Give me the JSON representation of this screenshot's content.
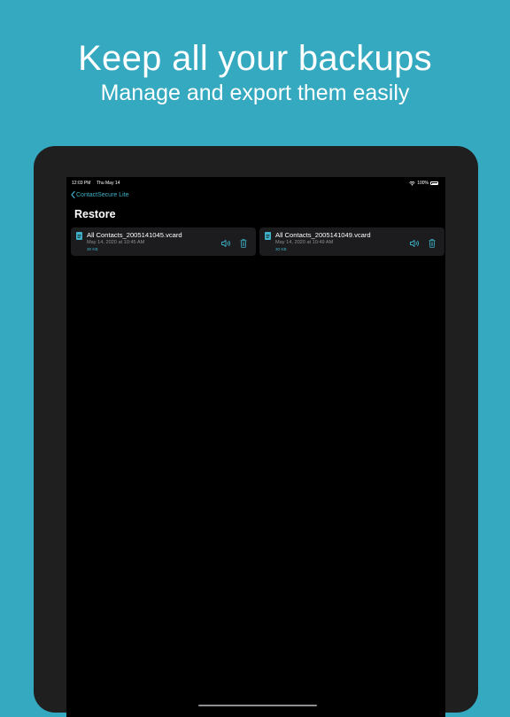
{
  "promo": {
    "headline": "Keep all your backups",
    "subheadline": "Manage and export them easily"
  },
  "status_bar": {
    "time": "12:03 PM",
    "date": "Thu May 14",
    "battery": "100%"
  },
  "nav": {
    "back_label": "ContactSecure Lite",
    "title": "Restore"
  },
  "backups": [
    {
      "name": "All Contacts_2005141045.vcard",
      "date": "May 14, 2020 at 10:45 AM",
      "size": "30 KB"
    },
    {
      "name": "All Contacts_2005141049.vcard",
      "date": "May 14, 2020 at 10:49 AM",
      "size": "30 KB"
    }
  ],
  "colors": {
    "background": "#35a9bf",
    "accent": "#3db2c9",
    "device_frame": "#1f1f1f",
    "screen": "#000000",
    "card": "#1c1c1e"
  },
  "icons": {
    "back": "chevron-left-icon",
    "file": "vcard-file-icon",
    "share": "share-audio-icon",
    "delete": "trash-icon",
    "wifi": "wifi-icon",
    "battery": "battery-icon"
  }
}
